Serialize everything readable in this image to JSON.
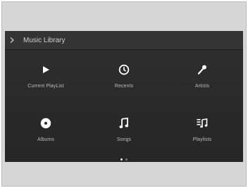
{
  "header": {
    "title": "Music Library",
    "back_icon": "chevron-right-icon"
  },
  "tiles": [
    {
      "label": "Current PlayList",
      "icon": "play-icon"
    },
    {
      "label": "Recents",
      "icon": "clock-icon"
    },
    {
      "label": "Artists",
      "icon": "microphone-icon"
    },
    {
      "label": "Albums",
      "icon": "disc-icon"
    },
    {
      "label": "Songs",
      "icon": "music-note-icon"
    },
    {
      "label": "Playlists",
      "icon": "playlist-icon"
    }
  ],
  "pagination": {
    "pages": 2,
    "current": 1
  },
  "colors": {
    "screen_bg": "#2a2a2a",
    "text": "#c8c8c8",
    "icon": "#ffffff",
    "bezel": "#d6d6d6"
  }
}
